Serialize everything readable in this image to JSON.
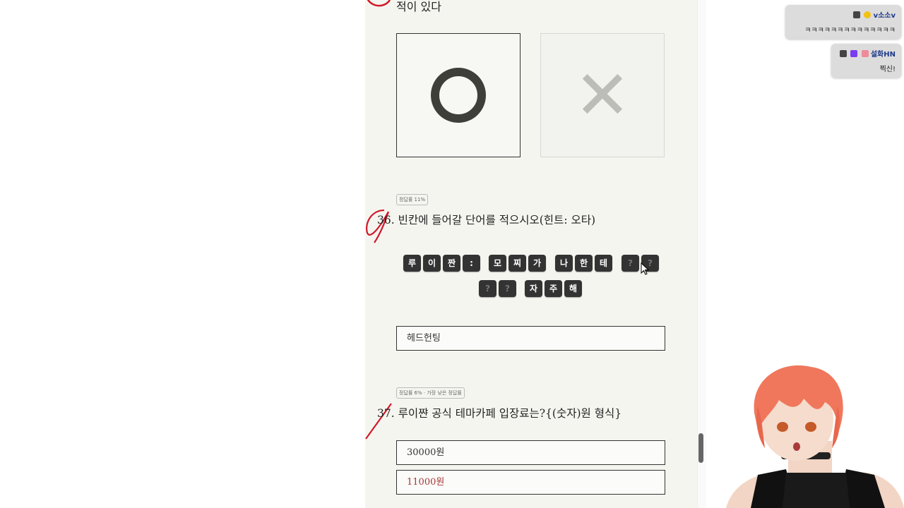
{
  "q35": {
    "title_tail": "적이 있다",
    "option_o_label": "O",
    "option_x_label": "X"
  },
  "q36": {
    "badge": "정답률 11%",
    "number": "36.",
    "text": "빈칸에 들어갈 단어를 적으시오(힌트: 오타)",
    "tiles_row1": [
      "루",
      "이",
      "짠",
      ":",
      "모",
      "찌",
      "가",
      "나",
      "한",
      "테",
      "?",
      "?"
    ],
    "tiles_row2": [
      "?",
      "?",
      "자",
      "주",
      "해"
    ],
    "answer": "헤드헌팅"
  },
  "q37": {
    "badge": "정답률 6% · 가장 낮은 정답률",
    "number": "37.",
    "text": "루이쨘 공식 테마카페 입장료는?{(숫자)원 형식}",
    "answer_given": "30000원",
    "answer_correct": "11000원"
  },
  "chat": [
    {
      "name": "v소소v",
      "message": "ㅋㅋㅋㅋㅋㅋㅋㅋㅋㅋㅋㅋㅋㅋ"
    },
    {
      "name": "설화HN",
      "message": "찍신!"
    }
  ],
  "colors": {
    "tile": "#333333",
    "wrong_answer": "#a53838",
    "chat_name": "#1d3a8a",
    "red_pen": "#d11a2a"
  },
  "icons": [
    "o-mark-icon",
    "x-mark-icon",
    "mouse-cursor-icon",
    "chat-badge-icon",
    "avatar-streamer"
  ]
}
